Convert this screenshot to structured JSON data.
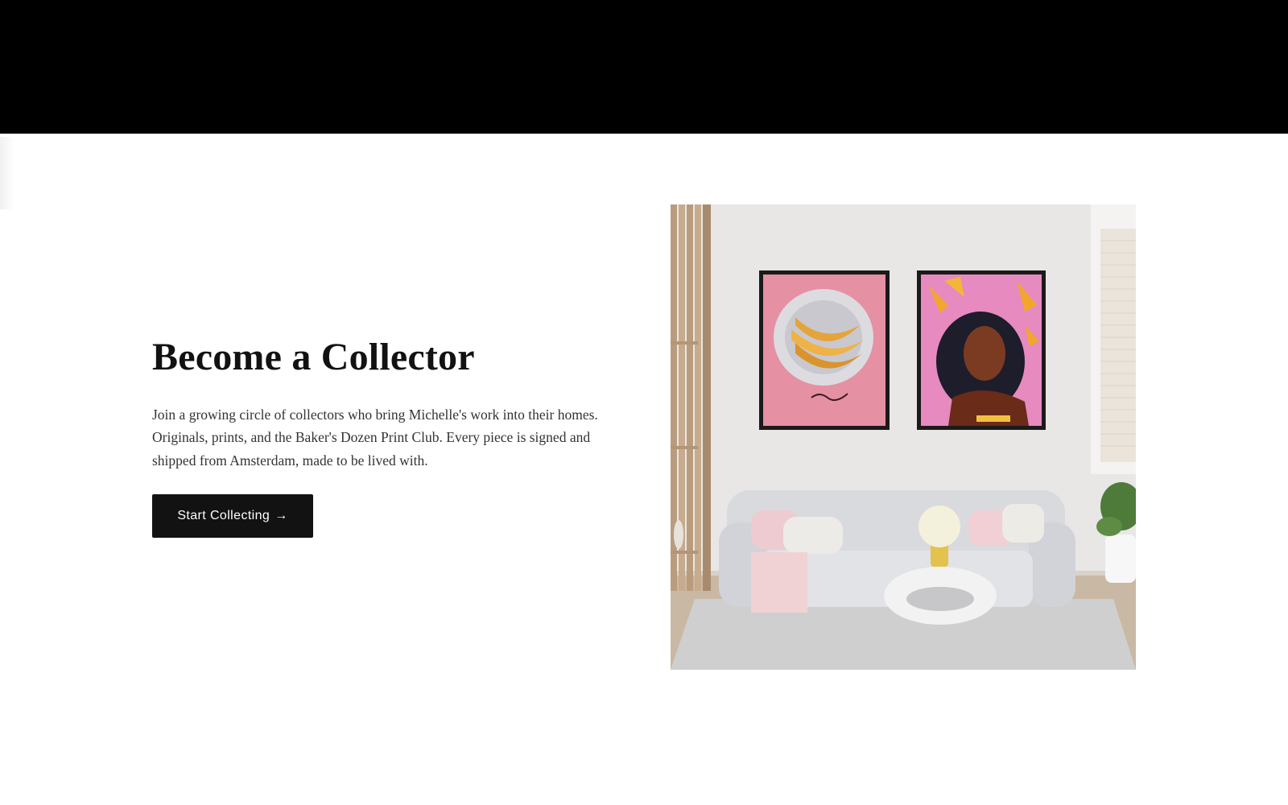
{
  "hero": {
    "heading": "Become a Collector",
    "body": "Join a growing circle of collectors who bring Michelle's work into their homes. Originals, prints, and the Baker's Dozen Print Club. Every piece is signed and shipped from Amsterdam, made to be lived with.",
    "cta_label": "Start Collecting",
    "cta_icon": "arrow-right-icon"
  },
  "colors": {
    "header_band": "#000000",
    "background": "#ffffff",
    "heading_text": "#121212",
    "body_text": "#333333",
    "button_bg": "#121212",
    "button_text": "#ffffff"
  },
  "image": {
    "description_icon": "room-scene-image"
  }
}
